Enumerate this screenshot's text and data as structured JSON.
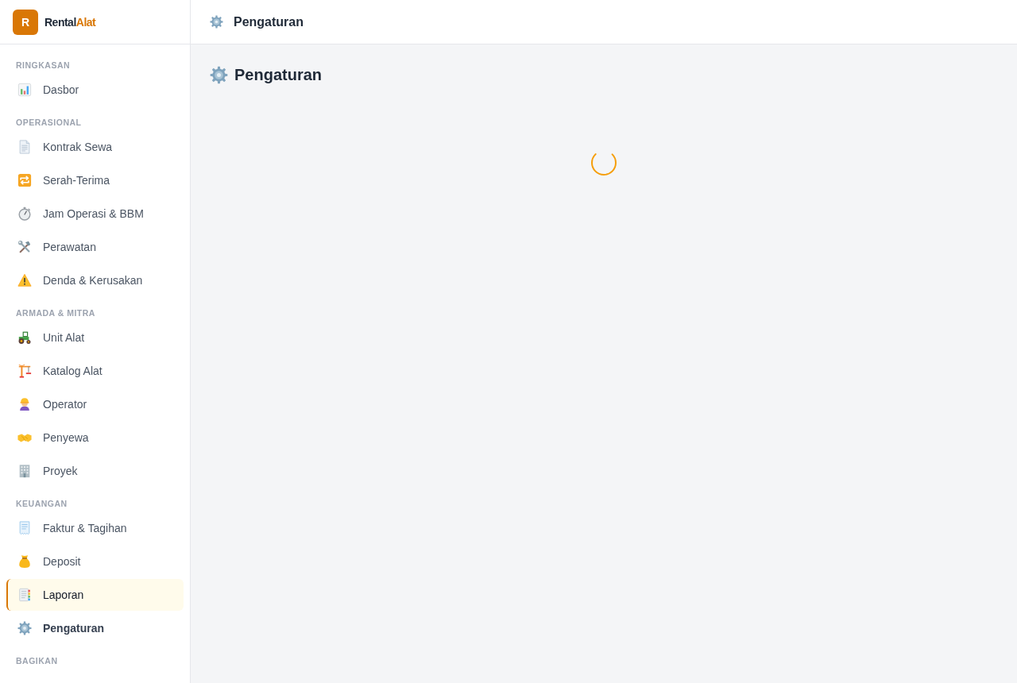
{
  "brand": {
    "logo_letter": "R",
    "name": "Rental",
    "name_accent": "Alat"
  },
  "sidebar": {
    "sections": [
      {
        "label": "RINGKASAN",
        "items": [
          {
            "label": "Dasbor",
            "hovered": false,
            "selected": false
          }
        ]
      },
      {
        "label": "OPERASIONAL",
        "items": [
          {
            "label": "Kontrak Sewa",
            "hovered": false,
            "selected": false
          },
          {
            "label": "Serah-Terima",
            "hovered": false,
            "selected": false
          },
          {
            "label": "Jam Operasi & BBM",
            "hovered": false,
            "selected": false
          },
          {
            "label": "Perawatan",
            "hovered": false,
            "selected": false
          },
          {
            "label": "Denda & Kerusakan",
            "hovered": false,
            "selected": false
          }
        ]
      },
      {
        "label": "ARMADA & MITRA",
        "items": [
          {
            "label": "Unit Alat",
            "hovered": false,
            "selected": false
          },
          {
            "label": "Katalog Alat",
            "hovered": false,
            "selected": false
          },
          {
            "label": "Operator",
            "hovered": false,
            "selected": false
          },
          {
            "label": "Penyewa",
            "hovered": false,
            "selected": false
          },
          {
            "label": "Proyek",
            "hovered": false,
            "selected": false
          }
        ]
      },
      {
        "label": "KEUANGAN",
        "items": [
          {
            "label": "Faktur & Tagihan",
            "hovered": false,
            "selected": false
          },
          {
            "label": "Deposit",
            "hovered": false,
            "selected": false
          },
          {
            "label": "Laporan",
            "hovered": true,
            "selected": false
          },
          {
            "label": "Pengaturan",
            "hovered": false,
            "selected": true
          }
        ]
      },
      {
        "label": "BAGIKAN"
      }
    ]
  },
  "header": {
    "title": "Pengaturan"
  },
  "main": {
    "title": "Pengaturan",
    "loading": true
  }
}
